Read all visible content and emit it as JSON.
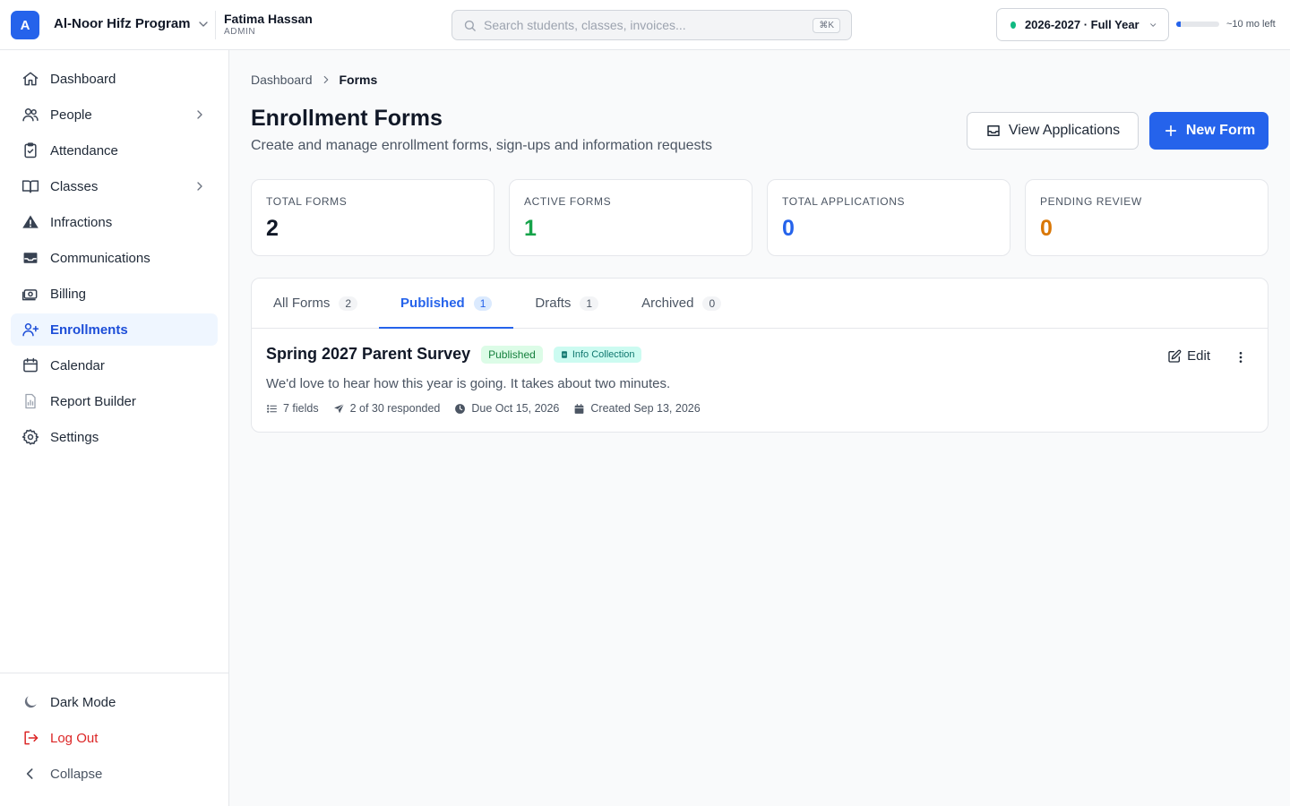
{
  "org": {
    "logo_letter": "A",
    "name": "Al-Noor Hifz Program"
  },
  "user": {
    "name": "Fatima Hassan",
    "role": "ADMIN"
  },
  "search": {
    "placeholder": "Search students, classes, invoices...",
    "shortcut": "⌘K"
  },
  "school_year": {
    "label": "2026-2027 · Full Year",
    "status_color": "#10b981",
    "remaining": "~10 mo left",
    "elapsed_fraction": 0.1
  },
  "sidebar": {
    "items": [
      {
        "label": "Dashboard",
        "icon": "home-icon"
      },
      {
        "label": "People",
        "icon": "users-icon",
        "has_children": true
      },
      {
        "label": "Attendance",
        "icon": "clipboard-check-icon"
      },
      {
        "label": "Classes",
        "icon": "book-open-icon",
        "has_children": true
      },
      {
        "label": "Infractions",
        "icon": "warning-icon"
      },
      {
        "label": "Communications",
        "icon": "inbox-icon"
      },
      {
        "label": "Billing",
        "icon": "money-icon"
      },
      {
        "label": "Enrollments",
        "icon": "user-plus-icon",
        "active": true
      },
      {
        "label": "Calendar",
        "icon": "calendar-icon"
      },
      {
        "label": "Report Builder",
        "icon": "report-icon"
      },
      {
        "label": "Settings",
        "icon": "gear-icon"
      }
    ],
    "bottom": {
      "dark_mode": "Dark Mode",
      "logout": "Log Out",
      "collapse": "Collapse"
    }
  },
  "breadcrumb": {
    "parent": "Dashboard",
    "current": "Forms"
  },
  "page": {
    "title": "Enrollment Forms",
    "subtitle": "Create and manage enrollment forms, sign-ups and information requests",
    "view_applications": "View Applications",
    "new_form": "New Form"
  },
  "stats": [
    {
      "label": "TOTAL FORMS",
      "value": "2",
      "color": "#111827"
    },
    {
      "label": "ACTIVE FORMS",
      "value": "1",
      "color": "#16a34a"
    },
    {
      "label": "TOTAL APPLICATIONS",
      "value": "0",
      "color": "#2563eb"
    },
    {
      "label": "PENDING REVIEW",
      "value": "0",
      "color": "#d97706"
    }
  ],
  "tabs": [
    {
      "label": "All Forms",
      "count": "2"
    },
    {
      "label": "Published",
      "count": "1",
      "active": true
    },
    {
      "label": "Drafts",
      "count": "1"
    },
    {
      "label": "Archived",
      "count": "0"
    }
  ],
  "forms": [
    {
      "title": "Spring 2027 Parent Survey",
      "status": "Published",
      "type": "Info Collection",
      "description": "We'd love to hear how this year is going. It takes about two minutes.",
      "fields": "7 fields",
      "responses": "2 of 30 responded",
      "due": "Due Oct 15, 2026",
      "created": "Created Sep 13, 2026",
      "edit_label": "Edit"
    }
  ],
  "colors": {
    "accent": "#2563eb",
    "active_bg": "#eff6ff",
    "danger": "#dc2626"
  }
}
